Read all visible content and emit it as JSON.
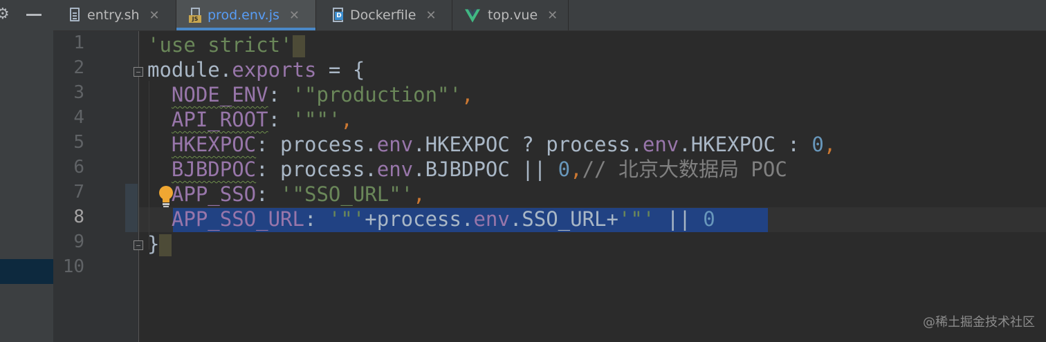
{
  "tabs": [
    {
      "label": "entry.sh",
      "icon": "shell-file-icon",
      "active": false
    },
    {
      "label": "prod.env.js",
      "icon": "js-file-icon",
      "active": true
    },
    {
      "label": "Dockerfile",
      "icon": "dockerfile-icon",
      "active": false
    },
    {
      "label": "top.vue",
      "icon": "vue-file-icon",
      "active": false
    }
  ],
  "close_glyph": "✕",
  "gutter": {
    "line_numbers": [
      "1",
      "2",
      "3",
      "4",
      "5",
      "6",
      "7",
      "8",
      "9",
      "10"
    ],
    "current_line": "8"
  },
  "code": {
    "l1": {
      "str": "'use strict'"
    },
    "l2": {
      "a": "module",
      "b": ".",
      "c": "exports",
      "d": " = {"
    },
    "l3": {
      "prop": "NODE_ENV",
      "colon": ": ",
      "str": "'\"production\"'",
      "comma": ","
    },
    "l4": {
      "prop": "API_ROOT",
      "colon": ": ",
      "str": "'\"\"'",
      "comma": ","
    },
    "l5": {
      "prop": "HKEXPOC",
      "a": ": process.",
      "env1": "env",
      "b": ".HKEXPOC ? process.",
      "env2": "env",
      "c": ".HKEXPOC : ",
      "num": "0",
      "comma": ","
    },
    "l6": {
      "prop": "BJBDPOC",
      "a": ": process.",
      "env": "env",
      "b": ".BJBDPOC || ",
      "num": "0",
      "comma": ",",
      "comment": "// 北京大数据局 POC"
    },
    "l7": {
      "prop": "APP_SSO",
      "colon": ": ",
      "str": "'\"SSO_URL\"'",
      "comma": ","
    },
    "l8": {
      "prop": "APP_SSO_URL",
      "colon": ": ",
      "str1": "'\"'",
      "a": "+process.",
      "env": "env",
      "b": ".SSO_URL+",
      "str2": "'\"'",
      "c": " || ",
      "num": "0"
    },
    "l9": {
      "brace": "}"
    }
  },
  "watermark": "@稀土掘金技术社区",
  "colors": {
    "editor_bg": "#2b2b2b",
    "string": "#6a8759",
    "property": "#9876aa",
    "number": "#6897bb",
    "keyword": "#cc7832",
    "comment": "#808080",
    "selection": "#214283",
    "active_tab_text": "#589df6"
  }
}
